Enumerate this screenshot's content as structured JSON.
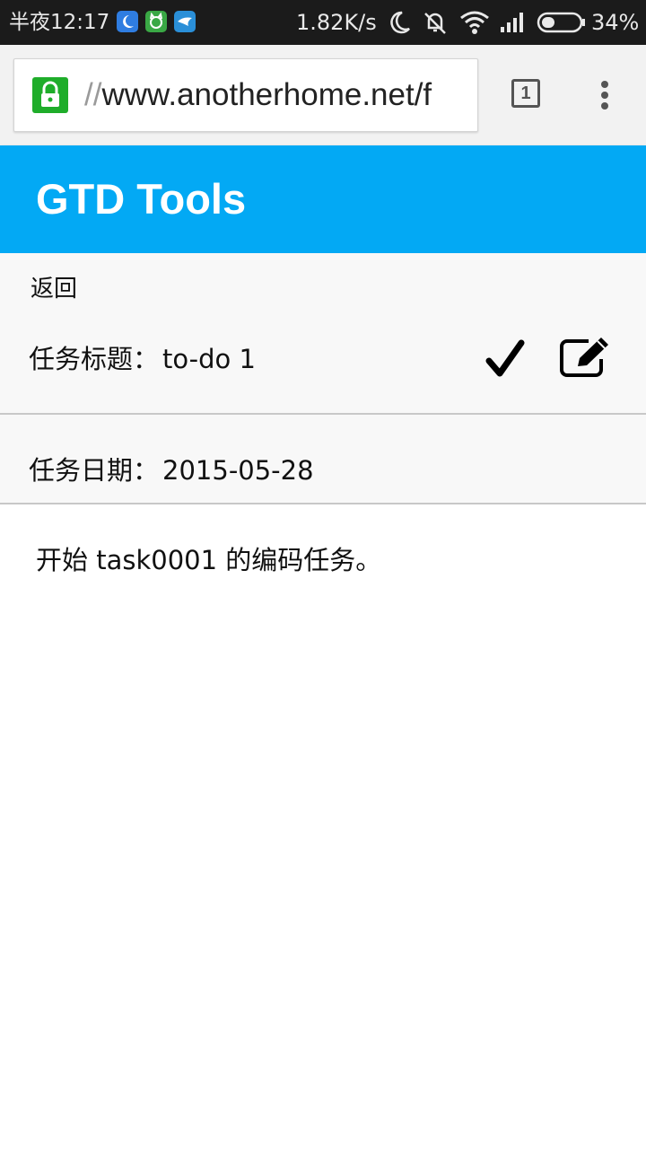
{
  "status_bar": {
    "time": "半夜12:17",
    "net_speed": "1.82K/s",
    "battery_percent": "34%",
    "battery_level": 0.34,
    "app_icons": [
      "moon-app-icon",
      "cat-app-icon",
      "bird-app-icon"
    ],
    "status_icons": [
      "moon-icon",
      "mute-icon",
      "wifi-icon",
      "signal-icon",
      "battery-icon"
    ]
  },
  "browser": {
    "url_scheme": "//",
    "url_host": "www.anotherhome.net/f",
    "tab_count": "1"
  },
  "app": {
    "title": "GTD Tools",
    "accent_color": "#03a9f4"
  },
  "task": {
    "back_label": "返回",
    "title_label": "任务标题：",
    "title_value": "to-do 1",
    "date_label": "任务日期：",
    "date_value": "2015-05-28",
    "description": "开始 task0001 的编码任务。"
  }
}
